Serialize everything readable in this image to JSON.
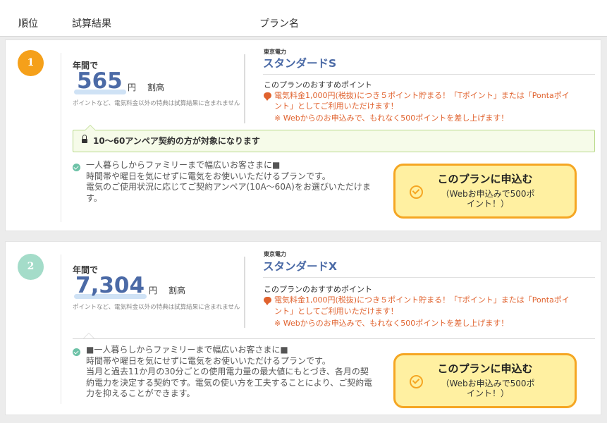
{
  "header": {
    "rank_label": "順位",
    "result_label": "試算結果",
    "plan_label": "プラン名"
  },
  "colors": {
    "rank1": "#f5a01a",
    "rank2": "#a4dcc9",
    "plan_blue": "#4b6aa6",
    "orange_text": "#e0622e",
    "button_fill": "#fff0a1",
    "button_border": "#f5a623"
  },
  "plans": [
    {
      "rank": "1",
      "annual_label": "年間で",
      "amount": "565",
      "yen": "円",
      "direction": "割高",
      "note": "ポイントなど、電気料金以外の特典は試算結果に含まれません",
      "provider": "東京電力",
      "plan_name": "スタンダードS",
      "rec_label": "このプランのおすすめポイント",
      "rec_line1": "電気料金1,000円(税抜)につき５ポイント貯まる！「Tポイント」または「Pontaポイ",
      "rec_line2": "ント」としてご利用いただけます！",
      "rec_sub": "※ Webからのお申込みで、もれなく500ポイントを差し上げます！",
      "ampere_notice": "10～60アンペア契約の方が対象になります",
      "desc_lines": [
        "一人暮らしからファミリーまで幅広いお客さまに■",
        "時間帯や曜日を気にせずに電気をお使いいただけるプランです。",
        "電気のご使用状況に応じてご契約アンペア(10A～60A)をお選びいただけま",
        "す。"
      ],
      "apply_title": "このプランに申込む",
      "apply_sub": "（Webお申込みで500ポイント！）"
    },
    {
      "rank": "2",
      "annual_label": "年間で",
      "amount": "7,304",
      "yen": "円",
      "direction": "割高",
      "note": "ポイントなど、電気料金以外の特典は試算結果に含まれません",
      "provider": "東京電力",
      "plan_name": "スタンダードX",
      "rec_label": "このプランのおすすめポイント",
      "rec_line1": "電気料金1,000円(税抜)につき５ポイント貯まる！「Tポイント」または「Pontaポイ",
      "rec_line2": "ント」としてご利用いただけます！",
      "rec_sub": "※ Webからのお申込みで、もれなく500ポイントを差し上げます！",
      "desc_lines": [
        "■一人暮らしからファミリーまで幅広いお客さまに■",
        "時間帯や曜日を気にせずに電気をお使いいただけるプランです。",
        "当月と過去11か月の30分ごとの使用電力量の最大値にもとづき、各月の契",
        "約電力を決定する契約です。電気の使い方を工夫することにより、ご契約電",
        "力を抑えることができます。"
      ],
      "apply_title": "このプランに申込む",
      "apply_sub": "（Webお申込みで500ポイント！）"
    }
  ]
}
